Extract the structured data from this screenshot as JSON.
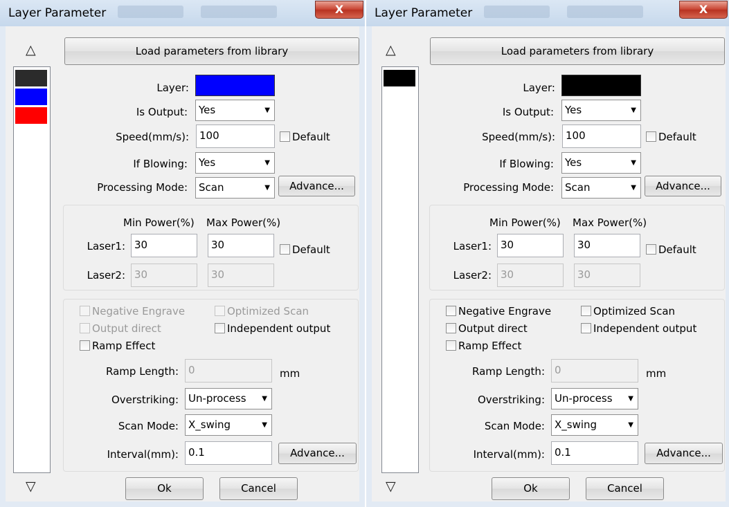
{
  "dialogs": [
    {
      "title": "Layer Parameter",
      "close_label": "X",
      "layers": [
        {
          "color": "#2b2b2b"
        },
        {
          "color": "#0000ff"
        },
        {
          "color": "#ff0000"
        }
      ],
      "load_button": "Load parameters from library",
      "layer_label": "Layer:",
      "layer_color": "#0000ff",
      "is_output_label": "Is Output:",
      "is_output_value": "Yes",
      "speed_label": "Speed(mm/s):",
      "speed_value": "100",
      "default_label": "Default",
      "if_blowing_label": "If Blowing:",
      "if_blowing_value": "Yes",
      "processing_mode_label": "Processing Mode:",
      "processing_mode_value": "Scan",
      "advance_label": "Advance...",
      "min_power_label": "Min Power(%)",
      "max_power_label": "Max Power(%)",
      "laser1_label": "Laser1:",
      "laser1_min": "30",
      "laser1_max": "30",
      "power_default_label": "Default",
      "laser2_label": "Laser2:",
      "laser2_min": "30",
      "laser2_max": "30",
      "negative_engrave": "Negative Engrave",
      "optimized_scan": "Optimized Scan",
      "output_direct": "Output direct",
      "independent_output": "Independent output",
      "ramp_effect": "Ramp Effect",
      "options_disabled": true,
      "ramp_length_label": "Ramp Length:",
      "ramp_length_value": "0",
      "ramp_unit": "mm",
      "overstriking_label": "Overstriking:",
      "overstriking_value": "Un-process",
      "scan_mode_label": "Scan Mode:",
      "scan_mode_value": "X_swing",
      "interval_label": "Interval(mm):",
      "interval_value": "0.1",
      "advance2_label": "Advance...",
      "ok_label": "Ok",
      "cancel_label": "Cancel"
    },
    {
      "title": "Layer Parameter",
      "close_label": "X",
      "layers": [
        {
          "color": "#000000"
        }
      ],
      "load_button": "Load parameters from library",
      "layer_label": "Layer:",
      "layer_color": "#000000",
      "is_output_label": "Is Output:",
      "is_output_value": "Yes",
      "speed_label": "Speed(mm/s):",
      "speed_value": "100",
      "default_label": "Default",
      "if_blowing_label": "If Blowing:",
      "if_blowing_value": "Yes",
      "processing_mode_label": "Processing Mode:",
      "processing_mode_value": "Scan",
      "advance_label": "Advance...",
      "min_power_label": "Min Power(%)",
      "max_power_label": "Max Power(%)",
      "laser1_label": "Laser1:",
      "laser1_min": "30",
      "laser1_max": "30",
      "power_default_label": "Default",
      "laser2_label": "Laser2:",
      "laser2_min": "30",
      "laser2_max": "30",
      "negative_engrave": "Negative Engrave",
      "optimized_scan": "Optimized Scan",
      "output_direct": "Output direct",
      "independent_output": "Independent output",
      "ramp_effect": "Ramp Effect",
      "options_disabled": false,
      "ramp_length_label": "Ramp Length:",
      "ramp_length_value": "0",
      "ramp_unit": "mm",
      "overstriking_label": "Overstriking:",
      "overstriking_value": "Un-process",
      "scan_mode_label": "Scan Mode:",
      "scan_mode_value": "X_swing",
      "interval_label": "Interval(mm):",
      "interval_value": "0.1",
      "advance2_label": "Advance...",
      "ok_label": "Ok",
      "cancel_label": "Cancel"
    }
  ]
}
